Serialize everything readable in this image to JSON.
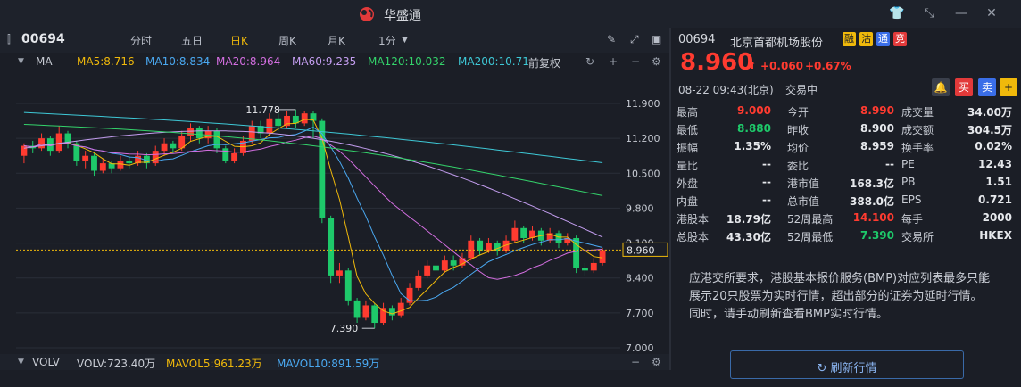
{
  "app": {
    "title": "华盛通"
  },
  "toolbar": {
    "code": "00694",
    "tabs": [
      "分时",
      "五日",
      "日K",
      "周K",
      "月K",
      "1分"
    ],
    "active_tab": "日K"
  },
  "ma_line": {
    "label": "MA",
    "ma5": "MA5:8.716",
    "ma10": "MA10:8.834",
    "ma20": "MA20:8.964",
    "ma60": "MA60:9.235",
    "ma120": "MA120:10.032",
    "ma200": "MA200:10.71",
    "adjust": "前复权"
  },
  "chart_data": {
    "type": "candlestick",
    "y_ticks": [
      "11.900",
      "11.200",
      "10.500",
      "9.800",
      "9.100",
      "8.400",
      "7.700",
      "7.000"
    ],
    "ylim": [
      7.0,
      11.9
    ],
    "current_price_label": "8.960",
    "current_price": 8.96,
    "high_label": "11.778",
    "high_value": 11.778,
    "low_label": "7.390",
    "low_value": 7.39,
    "candles": [
      [
        10.85,
        11.05,
        10.7,
        11.1
      ],
      [
        11.05,
        11.0,
        10.9,
        11.15
      ],
      [
        11.0,
        11.2,
        10.95,
        11.3
      ],
      [
        11.2,
        10.95,
        10.85,
        11.25
      ],
      [
        10.95,
        11.3,
        10.9,
        11.45
      ],
      [
        11.3,
        11.1,
        11.0,
        11.35
      ],
      [
        11.1,
        10.75,
        10.65,
        11.15
      ],
      [
        10.75,
        10.85,
        10.6,
        10.95
      ],
      [
        10.85,
        10.55,
        10.45,
        10.9
      ],
      [
        10.55,
        10.7,
        10.5,
        10.8
      ],
      [
        10.7,
        10.6,
        10.5,
        10.75
      ],
      [
        10.6,
        10.75,
        10.55,
        10.85
      ],
      [
        10.75,
        10.7,
        10.6,
        10.85
      ],
      [
        10.7,
        10.85,
        10.65,
        10.95
      ],
      [
        10.85,
        10.7,
        10.6,
        10.9
      ],
      [
        10.7,
        10.95,
        10.65,
        11.05
      ],
      [
        10.95,
        11.1,
        10.85,
        11.2
      ],
      [
        11.1,
        11.0,
        10.9,
        11.15
      ],
      [
        11.0,
        11.25,
        10.95,
        11.35
      ],
      [
        11.25,
        11.4,
        11.15,
        11.5
      ],
      [
        11.4,
        11.2,
        11.1,
        11.45
      ],
      [
        11.2,
        11.35,
        11.1,
        11.45
      ],
      [
        11.35,
        11.0,
        10.9,
        11.4
      ],
      [
        11.0,
        10.75,
        10.7,
        11.05
      ],
      [
        10.75,
        10.9,
        10.7,
        11.0
      ],
      [
        10.9,
        11.15,
        10.85,
        11.25
      ],
      [
        11.15,
        11.45,
        11.1,
        11.55
      ],
      [
        11.45,
        11.3,
        11.2,
        11.55
      ],
      [
        11.3,
        11.6,
        11.25,
        11.7
      ],
      [
        11.6,
        11.45,
        11.35,
        11.7
      ],
      [
        11.45,
        11.65,
        11.4,
        11.75
      ],
      [
        11.65,
        11.5,
        11.4,
        11.778
      ],
      [
        11.5,
        11.7,
        11.45,
        11.75
      ],
      [
        11.7,
        11.55,
        11.2,
        11.75
      ],
      [
        11.55,
        9.6,
        9.5,
        11.6
      ],
      [
        9.6,
        8.45,
        8.3,
        9.65
      ],
      [
        8.45,
        8.55,
        8.3,
        8.7
      ],
      [
        8.55,
        7.95,
        7.85,
        8.6
      ],
      [
        7.95,
        7.6,
        7.5,
        8.0
      ],
      [
        7.6,
        7.85,
        7.55,
        7.95
      ],
      [
        7.85,
        7.5,
        7.39,
        7.9
      ],
      [
        7.5,
        7.8,
        7.45,
        7.9
      ],
      [
        7.8,
        7.65,
        7.55,
        7.85
      ],
      [
        7.65,
        7.9,
        7.6,
        8.0
      ],
      [
        7.9,
        8.2,
        7.85,
        8.3
      ],
      [
        8.2,
        8.45,
        8.15,
        8.55
      ],
      [
        8.45,
        8.65,
        8.4,
        8.75
      ],
      [
        8.65,
        8.55,
        8.45,
        8.75
      ],
      [
        8.55,
        8.75,
        8.5,
        8.85
      ],
      [
        8.75,
        8.65,
        8.55,
        8.85
      ],
      [
        8.65,
        8.8,
        8.6,
        8.9
      ],
      [
        8.8,
        9.15,
        8.75,
        9.25
      ],
      [
        9.15,
        8.95,
        8.85,
        9.2
      ],
      [
        8.95,
        9.1,
        8.9,
        9.2
      ],
      [
        9.1,
        8.95,
        8.85,
        9.15
      ],
      [
        8.95,
        9.15,
        8.9,
        9.25
      ],
      [
        9.15,
        9.4,
        9.1,
        9.55
      ],
      [
        9.4,
        9.2,
        9.1,
        9.45
      ],
      [
        9.2,
        9.35,
        9.15,
        9.45
      ],
      [
        9.35,
        9.15,
        9.05,
        9.4
      ],
      [
        9.15,
        9.3,
        9.1,
        9.4
      ],
      [
        9.3,
        9.1,
        9.0,
        9.35
      ],
      [
        9.1,
        9.2,
        9.05,
        9.3
      ],
      [
        9.2,
        8.6,
        8.5,
        9.25
      ],
      [
        8.6,
        8.55,
        8.45,
        8.7
      ],
      [
        8.55,
        8.7,
        8.5,
        8.8
      ],
      [
        8.7,
        8.96,
        8.65,
        9.0
      ]
    ]
  },
  "vol_line": {
    "label": "VOLV",
    "volv": "VOLV:723.40万",
    "mavol5": "MAVOL5:961.23万",
    "mavol10": "MAVOL10:891.59万"
  },
  "quote": {
    "code": "00694",
    "name": "北京首都机场股份",
    "badges": [
      "融",
      "沽",
      "通",
      "竞"
    ],
    "price": "8.960",
    "change": "+0.060",
    "change_pct": "+0.67%",
    "time": "08-22 09:43(北京)",
    "status": "交易中",
    "btn_sell": "买",
    "btn_buy": "卖",
    "rows": [
      [
        [
          "最高",
          "9.000"
        ],
        [
          "今开",
          "8.990"
        ],
        [
          "成交量",
          "34.00万"
        ]
      ],
      [
        [
          "最低",
          "8.880"
        ],
        [
          "昨收",
          "8.900"
        ],
        [
          "成交额",
          "304.5万"
        ]
      ],
      [
        [
          "振幅",
          "1.35%"
        ],
        [
          "均价",
          "8.959"
        ],
        [
          "换手率",
          "0.02%"
        ]
      ],
      [
        [
          "量比",
          "--"
        ],
        [
          "委比",
          "--"
        ],
        [
          "PE",
          "12.43"
        ]
      ],
      [
        [
          "外盘",
          "--"
        ],
        [
          "港市值",
          "168.3亿"
        ],
        [
          "PB",
          "1.51"
        ]
      ],
      [
        [
          "内盘",
          "--"
        ],
        [
          "总市值",
          "388.0亿"
        ],
        [
          "EPS",
          "0.721"
        ]
      ],
      [
        [
          "港股本",
          "18.79亿"
        ],
        [
          "52周最高",
          "14.100"
        ],
        [
          "每手",
          "2000"
        ]
      ],
      [
        [
          "总股本",
          "43.30亿"
        ],
        [
          "52周最低",
          "7.390"
        ],
        [
          "交易所",
          "HKEX"
        ]
      ]
    ],
    "notice": "应港交所要求，港股基本报价服务(BMP)对应列表最多只能展示20只股票为实时行情，超出部分的证券为延时行情。同时，请手动刷新查看BMP实时行情。",
    "refresh_label": "刷新行情"
  }
}
